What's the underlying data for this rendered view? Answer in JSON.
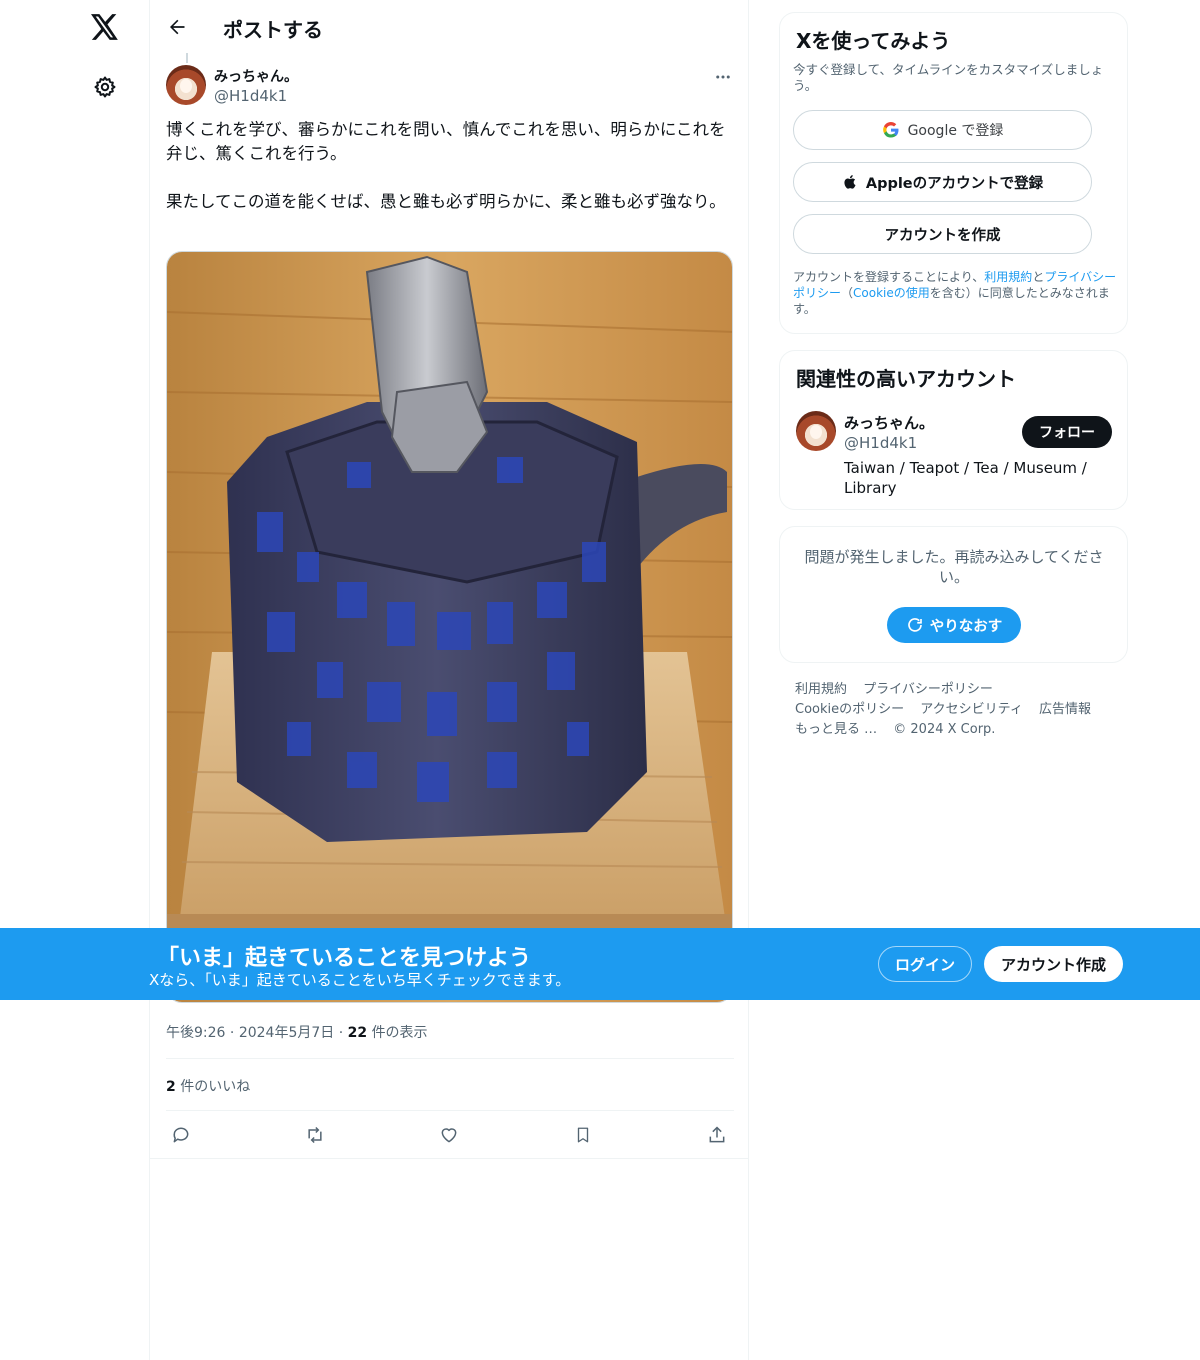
{
  "nav": {
    "logo_icon": "x-logo-icon",
    "settings_icon": "gear-icon"
  },
  "header": {
    "back_icon": "arrow-left-icon",
    "title": "ポストする"
  },
  "post": {
    "author_name": "みっちゃん。",
    "author_handle": "@H1d4k1",
    "more_icon": "more-dots-icon",
    "text_paragraph_1": "博くこれを学び、審らかにこれを問い、慎んでこれを思い、明らかにこれを弁じ、篤くこれを行う。",
    "text_paragraph_2": "果たしてこの道を能くせば、愚と雖も必ず明らかに、柔と雖も必ず強なり。",
    "time": "午後9:26",
    "date": "2024年5月7日",
    "views_count": "22",
    "views_label": "件の表示",
    "likes_count": "2",
    "likes_label": "件のいいね",
    "actions": [
      "reply-icon",
      "repost-icon",
      "like-icon",
      "bookmark-icon",
      "share-icon"
    ]
  },
  "signup_card": {
    "title": "Xを使ってみよう",
    "subtitle": "今すぐ登録して、タイムラインをカスタマイズしましょう。",
    "google_label": "Google で登録",
    "apple_label": "Appleのアカウントで登録",
    "create_label": "アカウントを作成",
    "legal_1": "アカウントを登録することにより、",
    "legal_terms": "利用規約",
    "legal_2": "と",
    "legal_privacy": "プライバシーポリシー",
    "legal_3": "（",
    "legal_cookie": "Cookieの使用",
    "legal_4": "を含む）に同意したとみなされます。"
  },
  "related": {
    "title": "関連性の高いアカウント",
    "name": "みっちゃん。",
    "handle": "@H1d4k1",
    "bio": "Taiwan / Teapot / Tea / Museum / Library",
    "follow_label": "フォロー"
  },
  "error_card": {
    "message": "問題が発生しました。再読み込みしてください。",
    "retry_label": "やりなおす"
  },
  "footer": {
    "links": [
      "利用規約",
      "プライバシーポリシー",
      "Cookieのポリシー",
      "アクセシビリティ",
      "広告情報",
      "もっと見る …",
      "© 2024 X Corp."
    ]
  },
  "banner": {
    "title": "「いま」起きていることを見つけよう",
    "subtitle": "Xなら、「いま」起きていることをいち早くチェックできます。",
    "login_label": "ログイン",
    "signup_label": "アカウント作成",
    "background": "#1d9bf0"
  },
  "colors": {
    "accent": "#1d9bf0",
    "text": "#0f1419",
    "secondary_text": "#536471"
  }
}
